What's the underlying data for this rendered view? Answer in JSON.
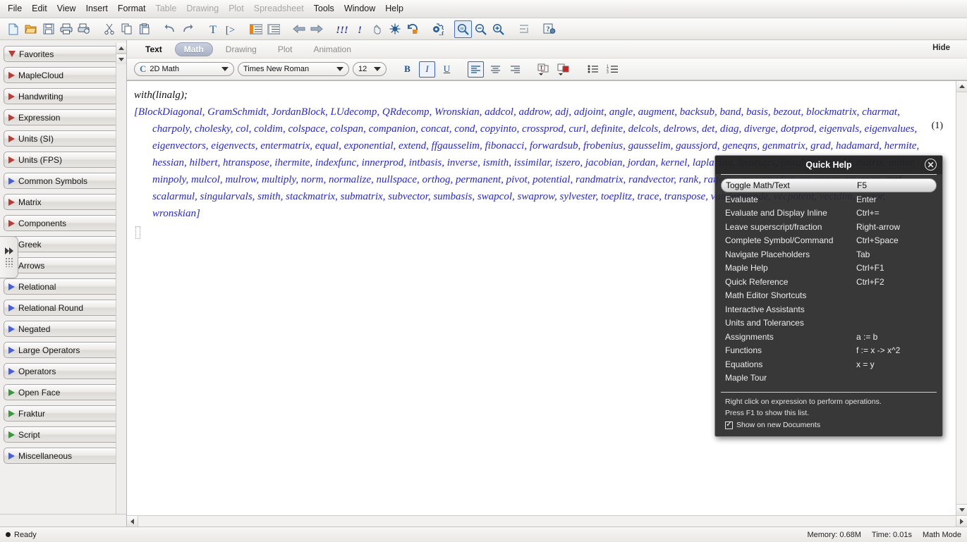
{
  "menubar": {
    "items": [
      {
        "label": "File",
        "enabled": true
      },
      {
        "label": "Edit",
        "enabled": true
      },
      {
        "label": "View",
        "enabled": true
      },
      {
        "label": "Insert",
        "enabled": true
      },
      {
        "label": "Format",
        "enabled": true
      },
      {
        "label": "Table",
        "enabled": false
      },
      {
        "label": "Drawing",
        "enabled": false
      },
      {
        "label": "Plot",
        "enabled": false
      },
      {
        "label": "Spreadsheet",
        "enabled": false
      },
      {
        "label": "Tools",
        "enabled": true
      },
      {
        "label": "Window",
        "enabled": true
      },
      {
        "label": "Help",
        "enabled": true
      }
    ]
  },
  "toolbar": {
    "buttons": [
      {
        "icon": "new-document-icon",
        "glyph": "⬜",
        "active": false
      },
      {
        "icon": "open-folder-icon",
        "glyph": "📂",
        "active": false
      },
      {
        "icon": "save-icon",
        "glyph": "💾",
        "active": false
      },
      {
        "icon": "print-icon",
        "glyph": "🖨",
        "active": false
      },
      {
        "icon": "print-preview-icon",
        "glyph": "🖶",
        "active": false
      },
      {
        "icon": "cut-icon",
        "glyph": "✂",
        "active": false
      },
      {
        "icon": "copy-icon",
        "glyph": "⧉",
        "active": false
      },
      {
        "icon": "paste-icon",
        "glyph": "📋",
        "active": false
      },
      {
        "icon": "undo-icon",
        "glyph": "↶",
        "active": false
      },
      {
        "icon": "redo-icon",
        "glyph": "↷",
        "active": false
      },
      {
        "icon": "text-mode-icon",
        "glyph": "T",
        "active": false
      },
      {
        "icon": "math-mode-icon",
        "glyph": "[>",
        "active": false
      },
      {
        "icon": "indent-increase-icon",
        "glyph": "≣",
        "active": false
      },
      {
        "icon": "indent-decrease-icon",
        "glyph": "≣",
        "active": false
      },
      {
        "icon": "back-arrow-icon",
        "glyph": "⇦",
        "active": false
      },
      {
        "icon": "forward-arrow-icon",
        "glyph": "⇨",
        "active": false
      },
      {
        "icon": "execute-worksheet-icon",
        "glyph": "!!!",
        "active": false
      },
      {
        "icon": "execute-icon",
        "glyph": "!",
        "active": false
      },
      {
        "icon": "stop-hand-icon",
        "glyph": "✋",
        "active": false
      },
      {
        "icon": "debug-icon",
        "glyph": "✱",
        "active": false
      },
      {
        "icon": "restart-icon",
        "glyph": "↺",
        "active": false
      },
      {
        "icon": "settings-gear-icon",
        "glyph": "⚙",
        "active": false
      },
      {
        "icon": "zoom-100-icon",
        "glyph": "🔍",
        "active": true
      },
      {
        "icon": "zoom-out-icon",
        "glyph": "🔍",
        "active": false
      },
      {
        "icon": "zoom-in-icon",
        "glyph": "🔍",
        "active": false
      },
      {
        "icon": "text-align-icon",
        "glyph": "⨍",
        "active": false
      },
      {
        "icon": "help-question-icon",
        "glyph": "?",
        "active": false
      }
    ]
  },
  "palette": {
    "items": [
      {
        "label": "Favorites",
        "expanded": true,
        "arrow_color": "#b0403c"
      },
      {
        "label": "MapleCloud",
        "expanded": false,
        "arrow_color": "#b0403c"
      },
      {
        "label": "Handwriting",
        "expanded": false,
        "arrow_color": "#b0403c"
      },
      {
        "label": "Expression",
        "expanded": false,
        "arrow_color": "#b0403c"
      },
      {
        "label": "Units (SI)",
        "expanded": false,
        "arrow_color": "#b0403c"
      },
      {
        "label": "Units (FPS)",
        "expanded": false,
        "arrow_color": "#b0403c"
      },
      {
        "label": "Common Symbols",
        "expanded": false,
        "arrow_color": "#4a5fd0"
      },
      {
        "label": "Matrix",
        "expanded": false,
        "arrow_color": "#b0403c"
      },
      {
        "label": "Components",
        "expanded": false,
        "arrow_color": "#b0403c"
      },
      {
        "label": "Greek",
        "expanded": false,
        "arrow_color": "#b0403c"
      },
      {
        "label": "Arrows",
        "expanded": false,
        "arrow_color": "#b0403c"
      },
      {
        "label": "Relational",
        "expanded": false,
        "arrow_color": "#4a5fd0"
      },
      {
        "label": "Relational Round",
        "expanded": false,
        "arrow_color": "#4a5fd0"
      },
      {
        "label": "Negated",
        "expanded": false,
        "arrow_color": "#4a5fd0"
      },
      {
        "label": "Large Operators",
        "expanded": false,
        "arrow_color": "#4a5fd0"
      },
      {
        "label": "Operators",
        "expanded": false,
        "arrow_color": "#4a5fd0"
      },
      {
        "label": "Open Face",
        "expanded": false,
        "arrow_color": "#3f9440"
      },
      {
        "label": "Fraktur",
        "expanded": false,
        "arrow_color": "#3f9440"
      },
      {
        "label": "Script",
        "expanded": false,
        "arrow_color": "#3f9440"
      },
      {
        "label": "Miscellaneous",
        "expanded": false,
        "arrow_color": "#4a5fd0"
      }
    ]
  },
  "context_tabs": {
    "tabs": [
      {
        "label": "Text",
        "state": "enabled"
      },
      {
        "label": "Math",
        "state": "active"
      },
      {
        "label": "Drawing",
        "state": "disabled"
      },
      {
        "label": "Plot",
        "state": "disabled"
      },
      {
        "label": "Animation",
        "state": "disabled"
      }
    ],
    "hide_label": "Hide"
  },
  "format_bar": {
    "style_value": "2D Math",
    "font_value": "Times New Roman",
    "size_value": "12",
    "bold_label": "B",
    "italic_label": "I",
    "underline_label": "U",
    "bold_active": false,
    "italic_active": true,
    "underline_active": false,
    "align_left_active": true
  },
  "document": {
    "input": "with(linalg);",
    "equation_label": "(1)",
    "output_lines": [
      "[BlockDiagonal, GramSchmidt, JordanBlock, LUdecomp, QRdecomp, Wronskian, addcol, addrow, adj, adjoint, angle, augment, backsub, band, basis, bezout, blockmatrix, charmat,",
      "charpoly, cholesky, col, coldim, colspace, colspan, companion, concat, cond, copyinto, crossprod, curl, definite, delcols, delrows, det, diag, diverge, dotprod, eigenvals, eigenvalues,",
      "eigenvectors, eigenvects, entermatrix, equal, exponential, extend, ffgausselim, fibonacci, forwardsub, frobenius, gausselim, gaussjord, geneqns, genmatrix, grad, hadamard, hermite,",
      "hessian, hilbert, htranspose, ihermite, indexfunc, innerprod, intbasis, inverse, ismith, issimilar, iszero, jacobian, jordan, kernel, laplacian, leastsqrs, linsolve, matadd, matrix, minor,",
      "minpoly, mulcol, mulrow, multiply, norm, normalize, nullspace, orthog, permanent, pivot, potential, randmatrix, randvector, rank, ratform, row, rowdim, rowspace, rowspan, rref,",
      "scalarmul, singularvals, smith, stackmatrix, submatrix, subvector, sumbasis, swapcol, swaprow, sylvester, toeplitz, trace, transpose, vandermonde, vecpotent, vectdim, vector,",
      "wronskian]"
    ]
  },
  "quick_help": {
    "title": "Quick Help",
    "close_glyph": "✕",
    "rows": [
      {
        "label": "Toggle Math/Text",
        "key": "F5",
        "selected": true
      },
      {
        "label": "Evaluate",
        "key": "Enter",
        "selected": false
      },
      {
        "label": "Evaluate and Display Inline",
        "key": "Ctrl+=",
        "selected": false
      },
      {
        "label": "Leave superscript/fraction",
        "key": "Right-arrow",
        "selected": false
      },
      {
        "label": "Complete Symbol/Command",
        "key": "Ctrl+Space",
        "selected": false
      },
      {
        "label": "Navigate Placeholders",
        "key": "Tab",
        "selected": false
      },
      {
        "label": "Maple Help",
        "key": "Ctrl+F1",
        "selected": false
      },
      {
        "label": "Quick Reference",
        "key": "Ctrl+F2",
        "selected": false
      },
      {
        "label": "Math Editor Shortcuts",
        "key": "",
        "selected": false
      },
      {
        "label": "Interactive Assistants",
        "key": "",
        "selected": false
      },
      {
        "label": "Units and Tolerances",
        "key": "",
        "selected": false
      },
      {
        "label": "Assignments",
        "key": "a := b",
        "selected": false
      },
      {
        "label": "Functions",
        "key": "f := x -> x^2",
        "selected": false
      },
      {
        "label": "Equations",
        "key": "x = y",
        "selected": false
      },
      {
        "label": "Maple Tour",
        "key": "",
        "selected": false
      }
    ],
    "footer_line1": "Right click on expression to perform operations.",
    "footer_line2": "Press F1 to show this list.",
    "checkbox_label": "Show on new Documents",
    "checkbox_glyph": "✓",
    "checkbox_checked": true
  },
  "statusbar": {
    "ready_text": "Ready",
    "memory": "Memory: 0.68M",
    "time": "Time: 0.01s",
    "mode": "Math Mode"
  }
}
